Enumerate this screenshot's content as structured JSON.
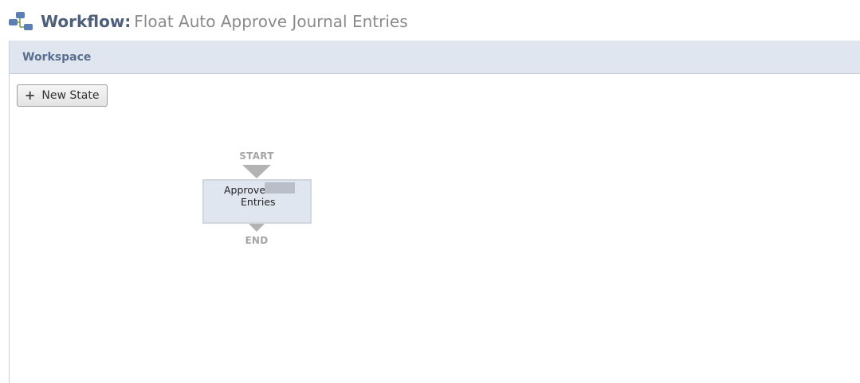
{
  "header": {
    "title_label": "Workflow:",
    "title_value": "Float Auto Approve Journal Entries",
    "icon": "workflow-icon"
  },
  "workspace": {
    "title": "Workspace",
    "new_state_button": {
      "icon": "plus-icon",
      "label": "New State"
    }
  },
  "diagram": {
    "start_label": "START",
    "end_label": "END",
    "state": {
      "line1": "Approve",
      "line2": "Entries"
    }
  },
  "colors": {
    "title_label": "#4d5f79",
    "title_value": "#8a8a8a",
    "workspace_bar": "#e0e6ef",
    "workspace_title": "#5a6f8e",
    "state_fill": "#e0e6ef",
    "connector": "#b3b3b3"
  }
}
